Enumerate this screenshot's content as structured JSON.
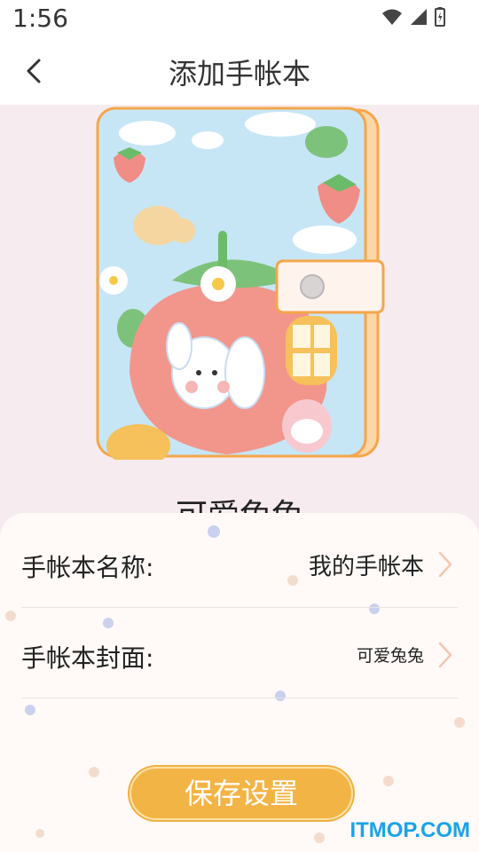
{
  "status_bar": {
    "time": "1:56",
    "icons": [
      "wifi-icon",
      "signal-icon",
      "battery-icon"
    ]
  },
  "header": {
    "title": "添加手帐本",
    "back_icon": "chevron-left-icon"
  },
  "cover": {
    "name": "可爱兔兔"
  },
  "form": {
    "rows": [
      {
        "label": "手帐本名称:",
        "value": "我的手帐本"
      },
      {
        "label": "手帐本封面:",
        "value": "可爱兔兔"
      }
    ]
  },
  "save_button": {
    "label": "保存设置"
  },
  "watermark": {
    "text": "ITMOP.COM"
  },
  "colors": {
    "accent": "#f3b446",
    "background": "#f6ecef",
    "sheet": "#fffaf7",
    "watermark": "#1aa3e8"
  }
}
